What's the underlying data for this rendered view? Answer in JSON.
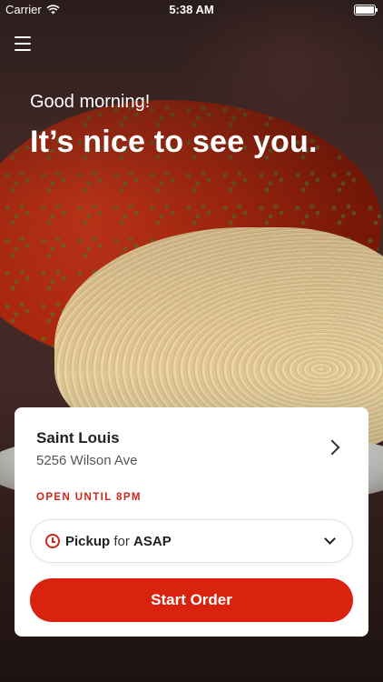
{
  "status_bar": {
    "carrier": "Carrier",
    "time": "5:38 AM",
    "wifi_icon": "wifi-icon",
    "battery_icon": "battery-icon"
  },
  "header": {
    "menu_icon": "hamburger-menu-icon"
  },
  "greeting": {
    "small": "Good morning!",
    "large": "It’s nice to see you."
  },
  "location_card": {
    "store_name": "Saint Louis",
    "store_address": "5256 Wilson Ave",
    "hours": "OPEN UNTIL 8PM",
    "hours_color": "#d0261a",
    "order_type": {
      "mode": "Pickup",
      "connector": "for",
      "time": "ASAP",
      "icon": "clock-icon"
    },
    "start_button_label": "Start Order",
    "accent_color": "#d9230f"
  }
}
